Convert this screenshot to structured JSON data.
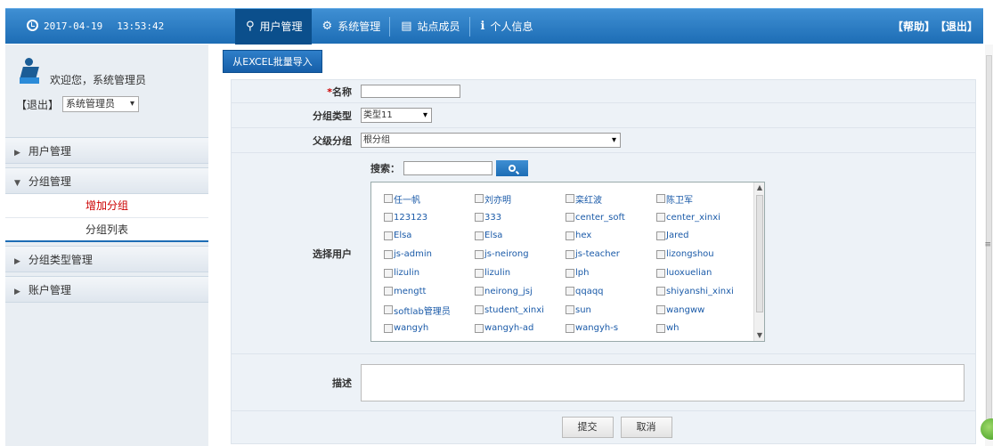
{
  "header": {
    "date": "2017-04-19",
    "time": "13:53:42",
    "tabs": [
      {
        "label": "用户管理",
        "icon": "lightbulb-icon"
      },
      {
        "label": "系统管理",
        "icon": "gear-icon"
      },
      {
        "label": "站点成员",
        "icon": "id-card-icon"
      },
      {
        "label": "个人信息",
        "icon": "info-icon"
      }
    ],
    "help_label": "【帮助】",
    "exit_label": "【退出】",
    "colors": {
      "bar": "#1d6db5",
      "active_tab": "#0b4f8c"
    }
  },
  "sidebar": {
    "welcome": "欢迎您，系统管理员",
    "logout": "【退出】",
    "role_value": "系统管理员",
    "menu": [
      {
        "label": "用户管理"
      },
      {
        "label": "分组管理"
      },
      {
        "label": "分组类型管理"
      },
      {
        "label": "账户管理"
      }
    ],
    "group_sub": [
      {
        "label": "增加分组"
      },
      {
        "label": "分组列表"
      }
    ]
  },
  "main": {
    "excel_button": "从EXCEL批量导入",
    "form": {
      "name_label": "名称",
      "name_required": "*",
      "type_label": "分组类型",
      "type_value": "类型11",
      "parent_label": "父级分组",
      "parent_value": "根分组",
      "users_label": "选择用户",
      "search_label": "搜索：",
      "users": [
        "任一帆",
        "刘亦明",
        "栾红波",
        "陈卫军",
        "123123",
        "333",
        "center_soft",
        "center_xinxi",
        "Elsa",
        "Elsa",
        "hex",
        "Jared",
        "js-admin",
        "js-neirong",
        "js-teacher",
        "lizongshou",
        "lizulin",
        "lizulin",
        "lph",
        "luoxuelian",
        "mengtt",
        "neirong_jsj",
        "qqaqq",
        "shiyanshi_xinxi",
        "softlab管理员",
        "student_xinxi",
        "sun",
        "wangww",
        "wangyh",
        "wangyh-ad",
        "wangyh-s",
        "wh"
      ],
      "desc_label": "描述",
      "submit_label": "提交",
      "cancel_label": "取消"
    }
  }
}
